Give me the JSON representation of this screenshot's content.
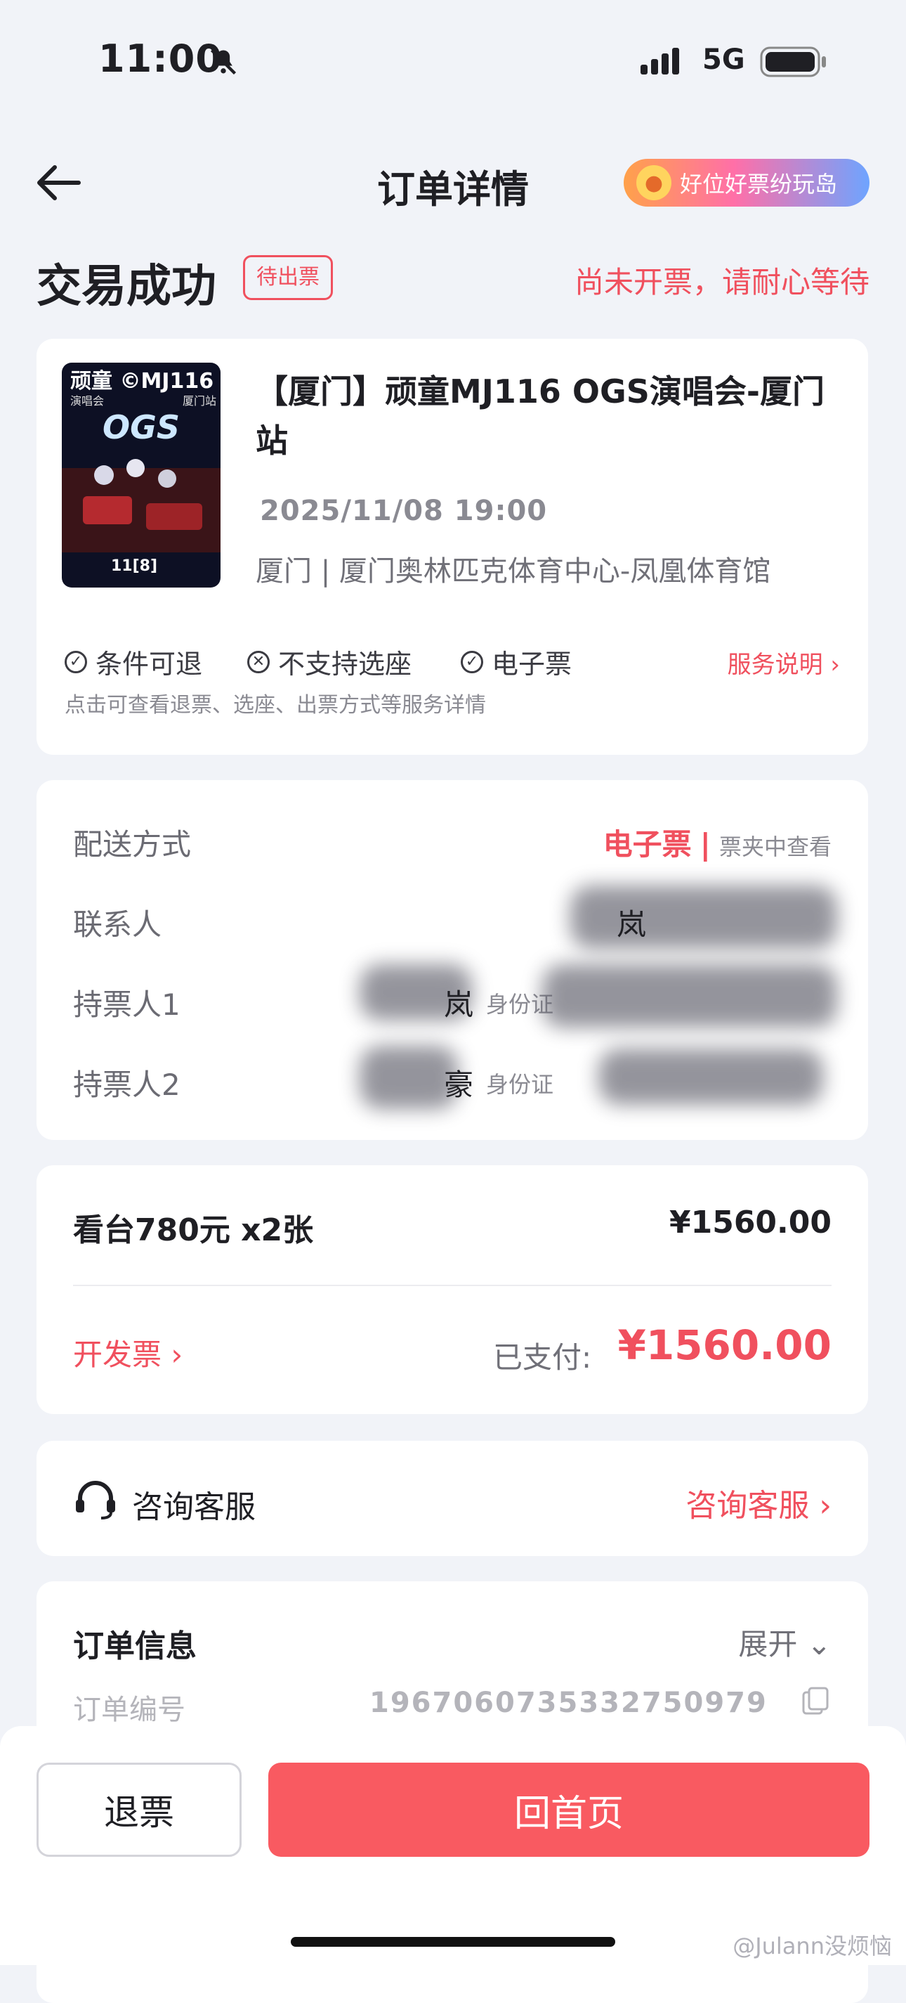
{
  "status_bar": {
    "time": "11:00",
    "network": "5G"
  },
  "nav": {
    "title": "订单详情",
    "promo": "好位好票纷玩岛"
  },
  "order_status": {
    "title": "交易成功",
    "badge": "待出票",
    "note": "尚未开票，请耐心等待"
  },
  "show": {
    "poster_text": {
      "brand": "顽童 ©MJ116",
      "sub": "演唱会",
      "city": "厦门站",
      "logo": "OGS",
      "date": "11[8]"
    },
    "title": "【厦门】顽童MJ116 OGS演唱会-厦门站",
    "datetime": "2025/11/08 19:00",
    "venue": "厦门 | 厦门奥林匹克体育中心-凤凰体育馆",
    "services": [
      "条件可退",
      "不支持选座",
      "电子票"
    ],
    "service_link": "服务说明",
    "service_hint": "点击可查看退票、选座、出票方式等服务详情"
  },
  "delivery": {
    "label": "配送方式",
    "value": "电子票",
    "sub": "票夹中查看",
    "contact_label": "联系人",
    "contact_name": "岚",
    "holder1_label": "持票人1",
    "holder1_name": "岚",
    "holder1_id": "身份证",
    "holder2_label": "持票人2",
    "holder2_name": "豪",
    "holder2_id": "身份证"
  },
  "price": {
    "item": "看台780元 x2张",
    "amount": "¥1560.00",
    "invoice": "开发票",
    "paid_label": "已支付:",
    "paid": "¥1560.00"
  },
  "support": {
    "label": "咨询客服",
    "link": "咨询客服"
  },
  "order_info": {
    "title": "订单信息",
    "expand": "展开",
    "number_label": "订单编号",
    "number": "1967060735332750979"
  },
  "actions": {
    "refund": "退票",
    "home": "回首页"
  },
  "watermark": "@Julann没烦恼",
  "colors": {
    "accent": "#f0505e",
    "primary_button": "#f95a61",
    "background": "#f1f3f8"
  }
}
